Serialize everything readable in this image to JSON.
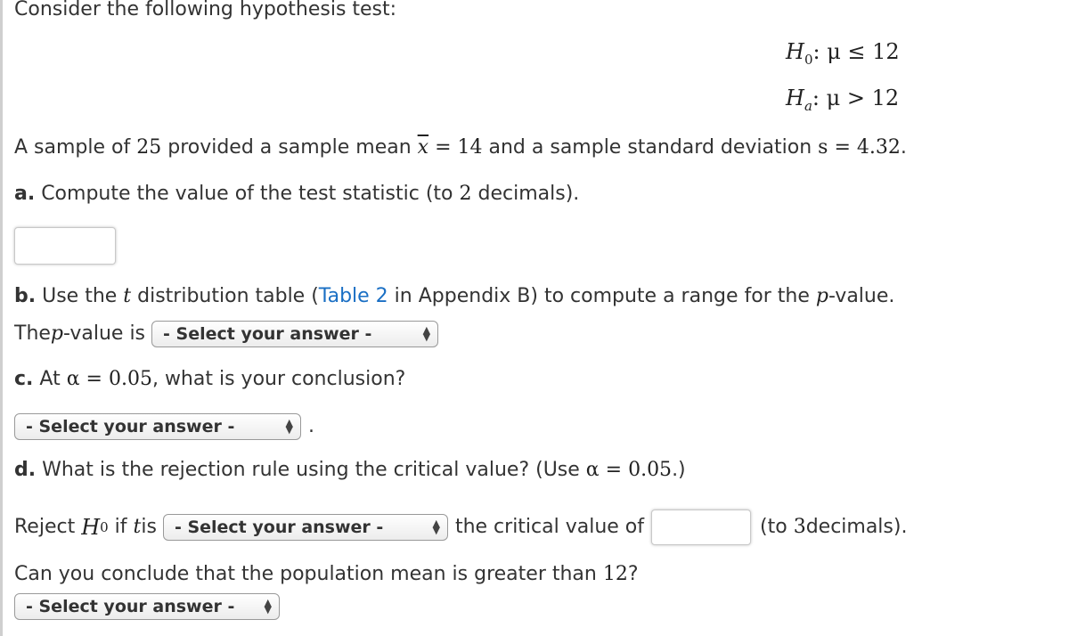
{
  "intro": "Consider the following hypothesis test:",
  "hypotheses": {
    "null": {
      "label": "H",
      "sub": "0",
      "relation": ":  μ ≤ 12"
    },
    "alt": {
      "label": "H",
      "sub": "a",
      "relation": ":  μ > 12"
    }
  },
  "sample": {
    "t1": "A sample of ",
    "n": "25",
    "t2": " provided a sample mean ",
    "xbar_symbol": "x",
    "xbar_eq": " = 14",
    "t3": " and a sample standard deviation ",
    "s_expr": "s = 4.32",
    "t4": "."
  },
  "part_a": {
    "label": "a.",
    "text": " Compute the value of the test statistic (to ",
    "decimals": "2",
    "text_end": " decimals).",
    "input_value": ""
  },
  "part_b": {
    "label": "b.",
    "t1": " Use the ",
    "t_var": "t",
    "t2": " distribution table (",
    "link": "Table 2",
    "t3": " in Appendix B) to compute a range for the ",
    "p_var": "p",
    "t4": "-value.",
    "line2_t1": "The ",
    "line2_p": "p",
    "line2_t2": "-value is",
    "select": "- Select your answer -"
  },
  "part_c": {
    "label": "c.",
    "t1": " At ",
    "alpha": "α = 0.05",
    "t2": ", what is your conclusion?",
    "select": "- Select your answer -",
    "after": "."
  },
  "part_d": {
    "label": "d.",
    "t1": " What is the rejection rule using the critical value? (Use ",
    "alpha": "α = 0.05",
    "t2": ".)",
    "reject": "Reject ",
    "h": "H",
    "h_sub": "0",
    "if_t": " if ",
    "t_var": "t",
    "is": " is",
    "select": "- Select your answer -",
    "crit": "the critical value of",
    "input_value": "",
    "to": "(to ",
    "decimals": "3",
    "to_end": " decimals)."
  },
  "final": {
    "question": "Can you conclude that the population mean is greater than ",
    "value": "12",
    "qmark": "?",
    "select": "- Select your answer -"
  }
}
